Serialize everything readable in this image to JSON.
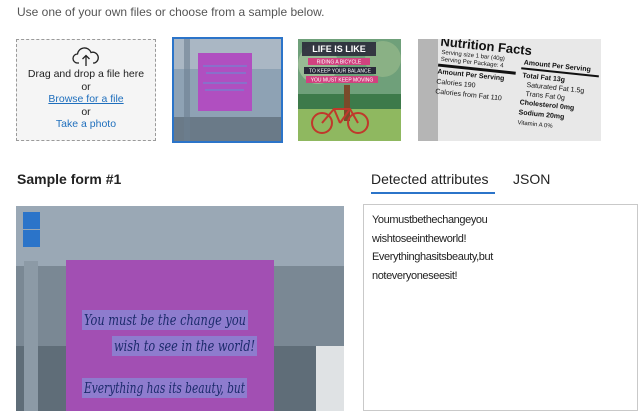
{
  "intro_text": "Use one of your own files or choose from a sample below.",
  "upload": {
    "icon": "cloud-upload-icon",
    "drag_text": "Drag and drop a file here",
    "or_1": "or",
    "browse_label": "Browse for a file",
    "or_2": "or",
    "photo_label": "Take a photo"
  },
  "samples": [
    {
      "name": "sticky-note-sample",
      "selected": true
    },
    {
      "name": "bicycle-poster-sample",
      "selected": false,
      "text": [
        "LIFE IS LIKE",
        "RIDING A BICYCLE",
        "TO KEEP YOUR BALANCE",
        "YOU MUST KEEP MOVING"
      ]
    },
    {
      "name": "nutrition-facts-sample",
      "selected": false,
      "text": [
        "Nutrition Facts",
        "Serving size 1 bar (40g)",
        "Serving Per Package: 4",
        "Amount Per Serving",
        "Calories 190",
        "Calories from Fat 110",
        "Amount Per Serving",
        "Total Fat 13g",
        "Saturated Fat 1.5g",
        "Trans Fat 0g",
        "Cholesterol 0mg",
        "Sodium 20mg",
        "Vitamin A 0%"
      ]
    }
  ],
  "section_title": "Sample form #1",
  "tabs": [
    {
      "label": "Detected attributes",
      "active": true
    },
    {
      "label": "JSON",
      "active": false
    }
  ],
  "preview": {
    "note_lines": [
      "You must be the change you",
      "wish to see in the world!",
      "Everything has its beauty, but"
    ]
  },
  "result_lines": [
    "Youmustbethechangeyou",
    "wishtoseeintheworld!",
    "Everythinghasitsbeauty,but",
    "noteveryoneseesit!"
  ],
  "colors": {
    "accent": "#2b74c9",
    "link": "#1f6fbd",
    "note": "#a24fb3"
  }
}
